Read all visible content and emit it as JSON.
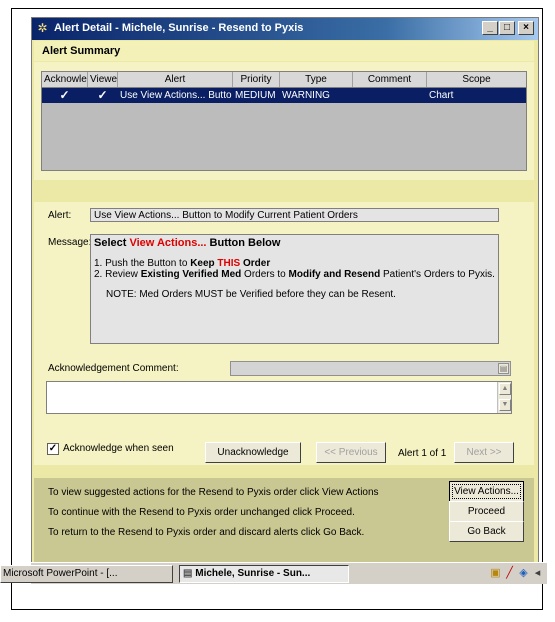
{
  "window": {
    "title": "Alert Detail - Michele, Sunrise - Resend to Pyxis",
    "minimize_glyph": "_",
    "maximize_glyph": "□",
    "close_glyph": "×"
  },
  "summary": {
    "heading": "Alert Summary",
    "columns": [
      "Acknowled",
      "Viewe",
      "Alert",
      "Priority",
      "Type",
      "Comment",
      "Scope"
    ],
    "rows": [
      {
        "acknowledged": "✓",
        "viewed": "✓",
        "alert": "Use View Actions... Button t",
        "priority": "MEDIUM",
        "type": "WARNING",
        "comment": "",
        "scope": "Chart"
      }
    ]
  },
  "detail": {
    "alert_label": "Alert:",
    "alert_value": "Use View Actions... Button to Modify Current Patient Orders",
    "message_label": "Message:",
    "message": {
      "line1_a": "Select ",
      "line1_red": "View Actions...",
      "line1_b": " Button Below",
      "line2_a": "1. Push the Button to ",
      "line2_bold": "Keep ",
      "line2_red": "THIS",
      "line2_bold2": " Order",
      "line3_a": "2. Review ",
      "line3_bold": "Existing Verified Med",
      "line3_b": " Orders to ",
      "line3_bold2": "Modify and Resend",
      "line3_c": " Patient's Orders to Pyxis.",
      "note": "NOTE:  Med Orders MUST be Verified before they can be Resent."
    },
    "ack_comment_label": "Acknowledgement Comment:",
    "ack_comment_value": ""
  },
  "controls": {
    "ack_when_seen_label": "Acknowledge when seen",
    "ack_when_seen_checked": true,
    "unacknowledge_label": "Unacknowledge",
    "previous_label": "<< Previous",
    "counter": "Alert 1 of 1",
    "next_label": "Next >>"
  },
  "actions": [
    {
      "text": "To view suggested actions for the Resend to Pyxis order click View Actions",
      "button": "View Actions..."
    },
    {
      "text": "To continue with the Resend to Pyxis order unchanged click Proceed.",
      "button": "Proceed"
    },
    {
      "text": "To return to the Resend to Pyxis order and discard alerts click Go Back.",
      "button": "Go Back"
    }
  ],
  "taskbar": {
    "items": [
      "Microsoft PowerPoint - [...",
      "Michele, Sunrise - Sun..."
    ]
  }
}
